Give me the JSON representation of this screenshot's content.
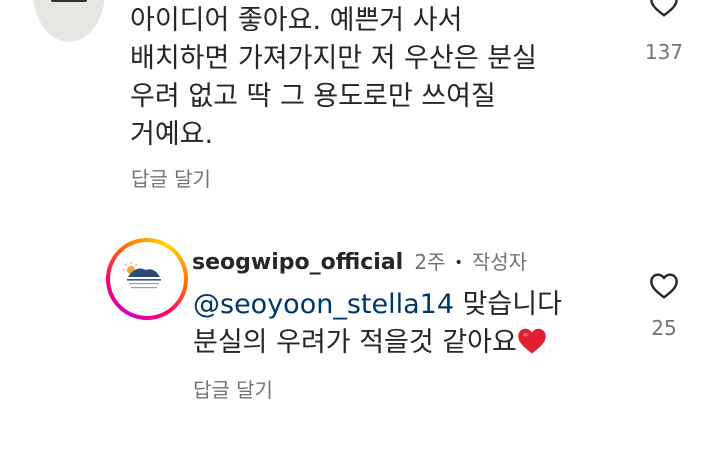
{
  "comment1": {
    "lines": [
      "아이디어 좋아요. 예쁜거 사서",
      "배치하면 가져가지만 저 우산은 분실",
      "우려 없고 딱 그 용도로만 쓰여질",
      "거예요."
    ],
    "reply_label": "답글 달기",
    "like_count": "137",
    "like_icon": "heart-outline-icon"
  },
  "comment2": {
    "username": "seogwipo_official",
    "time": "2주",
    "separator": "•",
    "author_badge": "작성자",
    "mention": "@seoyoon_stella14",
    "line1_rest": " 맞습니다",
    "line2": "분실의 우려가 적을것 같아요",
    "emoji_icon": "red-heart-emoji",
    "reply_label": "답글 달기",
    "like_count": "25",
    "like_icon": "heart-outline-icon"
  },
  "colors": {
    "text": "#262626",
    "secondary": "#737373",
    "mention": "#00376b",
    "heart_emoji": "#e0202e"
  }
}
